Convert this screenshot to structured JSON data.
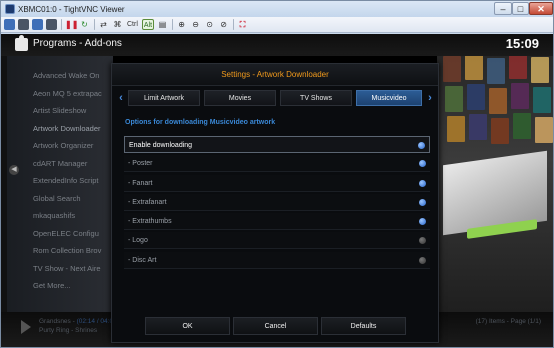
{
  "window": {
    "title": "XBMC01:0 - TightVNC Viewer",
    "min_glyph": "–",
    "max_glyph": "□",
    "close_glyph": "✕"
  },
  "toolbar": {
    "ctrl_label": "Ctrl",
    "alt_label": "Alt",
    "buttons": [
      {
        "icon": "new-connection-icon"
      },
      {
        "icon": "save-icon"
      },
      {
        "icon": "options-icon"
      },
      {
        "icon": "info-icon"
      },
      {
        "icon": "pause-icon"
      },
      {
        "icon": "refresh-icon"
      },
      {
        "icon": "transfer-icon"
      },
      {
        "icon": "ctrl-alt-del-icon"
      },
      {
        "icon": "ctrl-key-icon"
      },
      {
        "icon": "alt-key-icon"
      },
      {
        "icon": "clipboard-icon"
      },
      {
        "icon": "zoom-in-icon"
      },
      {
        "icon": "zoom-out-icon"
      },
      {
        "icon": "zoom-100-icon"
      },
      {
        "icon": "zoom-fit-icon"
      },
      {
        "icon": "fullscreen-icon"
      }
    ]
  },
  "xbmc": {
    "breadcrumb": "Programs  -  Add-ons",
    "clock": "15:09",
    "side_items": [
      "Advanced Wake On",
      "Aeon MQ 5 extrapac",
      "Artist Slideshow",
      "Artwork Downloader",
      "Artwork Organizer",
      "cdART Manager",
      "ExtendedInfo Script",
      "Global Search",
      "mkaquashifs",
      "OpenELEC Configu",
      "Rom Collection Brov",
      "TV Show - Next Aire",
      "Get More..."
    ],
    "now_playing": {
      "artist": "Grandsnes - ",
      "time": "(02:14 / 04:03)",
      "track": "Purty Ring - Shrines"
    },
    "items_info": "(17) Items - Page (1/1)"
  },
  "dialog": {
    "title": "Settings - Artwork Downloader",
    "tabs": [
      "Limit Artwork",
      "Movies",
      "TV Shows",
      "Musicvideo"
    ],
    "active_tab": "Musicvideo",
    "section_title": "Options for downloading Musicvideo artwork",
    "options": [
      {
        "label": "Enable downloading",
        "enabled": true
      },
      {
        "label": "- Poster",
        "enabled": true
      },
      {
        "label": "- Fanart",
        "enabled": true
      },
      {
        "label": "- Extrafanart",
        "enabled": true
      },
      {
        "label": "- Extrathumbs",
        "enabled": true
      },
      {
        "label": "- Logo",
        "enabled": false
      },
      {
        "label": "- Disc Art",
        "enabled": false
      }
    ],
    "buttons": {
      "ok": "OK",
      "cancel": "Cancel",
      "defaults": "Defaults"
    }
  },
  "colors": {
    "accent_orange": "#f09a1c",
    "accent_blue": "#3a88d6",
    "tab_active": "#2c5c95"
  }
}
